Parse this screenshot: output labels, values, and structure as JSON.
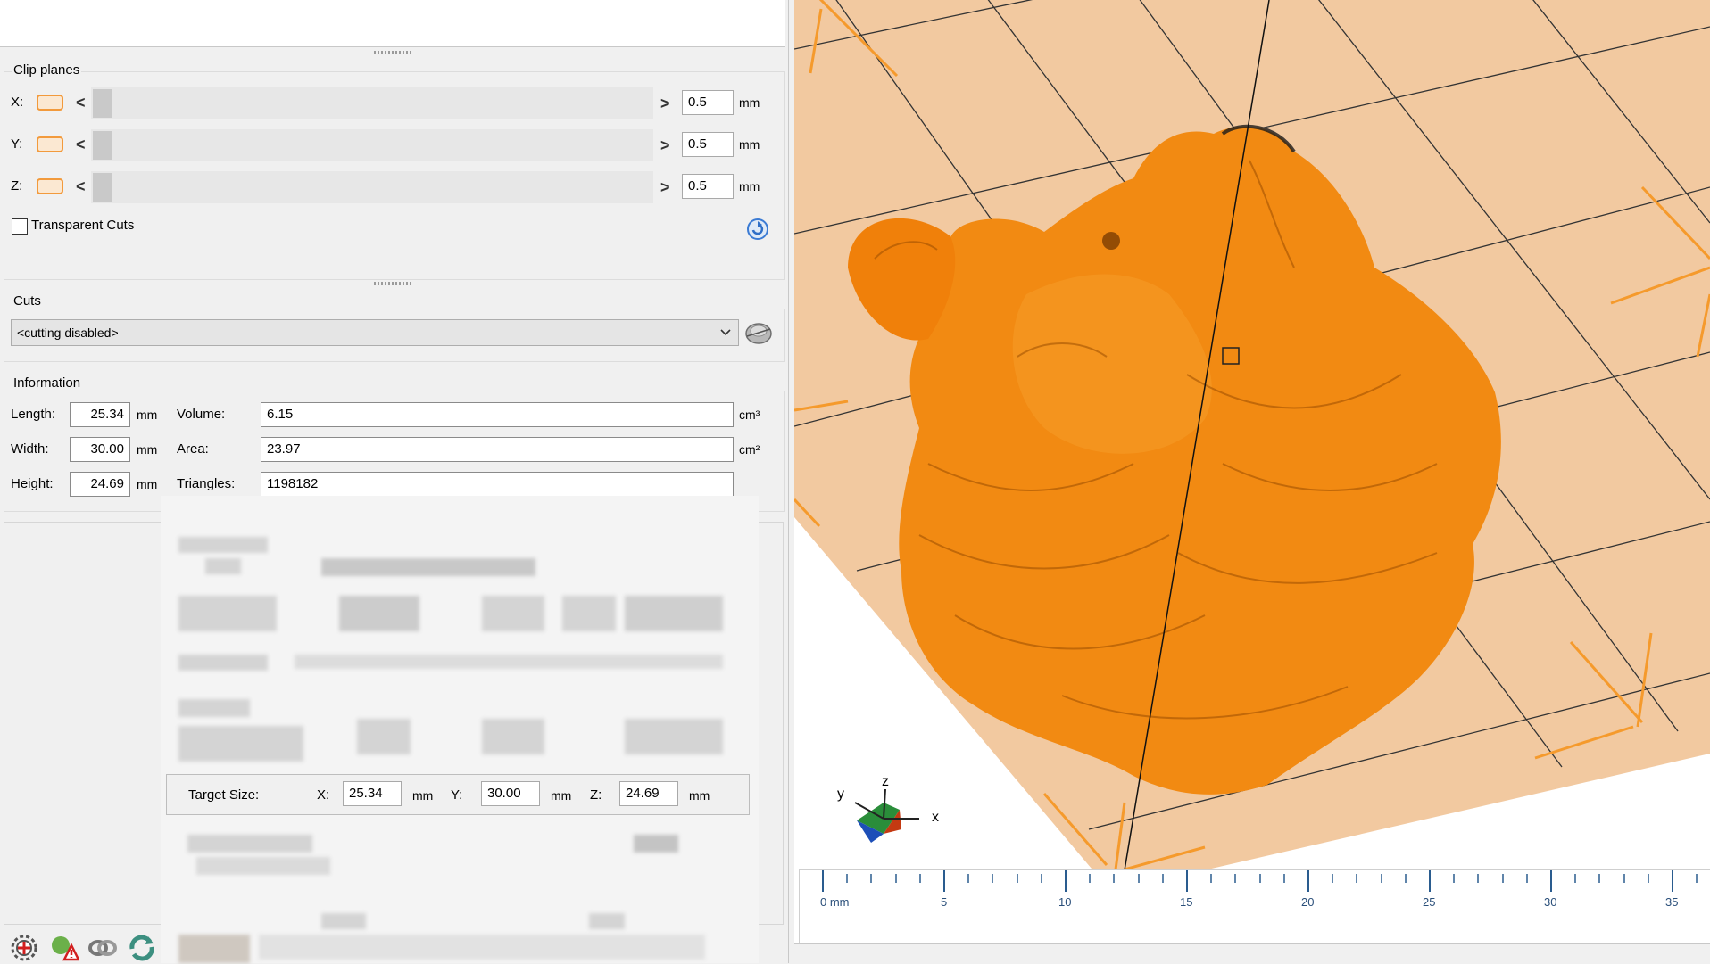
{
  "clip_planes": {
    "title": "Clip planes",
    "rows": [
      {
        "axis": "X:",
        "value": "0.5",
        "unit": "mm"
      },
      {
        "axis": "Y:",
        "value": "0.5",
        "unit": "mm"
      },
      {
        "axis": "Z:",
        "value": "0.5",
        "unit": "mm"
      }
    ],
    "arrow_left": "<",
    "arrow_right": ">",
    "transparent_cuts_label": "Transparent Cuts",
    "transparent_cuts_checked": false
  },
  "cuts": {
    "title": "Cuts",
    "selected": "<cutting disabled>"
  },
  "information": {
    "title": "Information",
    "length_label": "Length:",
    "length": "25.34",
    "length_unit": "mm",
    "width_label": "Width:",
    "width": "30.00",
    "width_unit": "mm",
    "height_label": "Height:",
    "height": "24.69",
    "height_unit": "mm",
    "volume_label": "Volume:",
    "volume": "6.15",
    "volume_unit": "cm³",
    "area_label": "Area:",
    "area": "23.97",
    "area_unit": "cm²",
    "triangles_label": "Triangles:",
    "triangles": "1198182"
  },
  "target_size": {
    "label": "Target Size:",
    "x_label": "X:",
    "x": "25.34",
    "y_label": "Y:",
    "y": "30.00",
    "z_label": "Z:",
    "z": "24.69",
    "unit": "mm"
  },
  "ruler": {
    "labels": [
      "0 mm",
      "5",
      "10",
      "15",
      "20",
      "25",
      "30",
      "35"
    ]
  },
  "axis_gizmo": {
    "x": "x",
    "y": "y",
    "z": "z"
  },
  "colors": {
    "model": "#f28a12",
    "bed": "#f2c9a0",
    "accent": "#f29a3c"
  },
  "toolbar_icons": [
    "repair-icon",
    "warning-icon",
    "rotate-icon",
    "refresh-icon"
  ]
}
